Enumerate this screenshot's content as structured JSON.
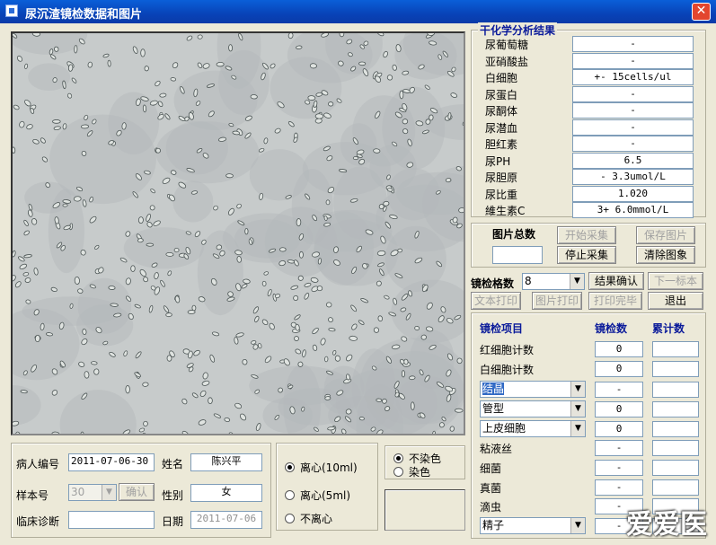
{
  "window": {
    "title": "尿沉渣镜检数据和图片"
  },
  "chem": {
    "title": "干化学分析结果",
    "items": [
      {
        "label": "尿葡萄糖",
        "value": "-"
      },
      {
        "label": "亚硝酸盐",
        "value": "-"
      },
      {
        "label": "白细胞",
        "value": "+-  15cells/ul"
      },
      {
        "label": "尿蛋白",
        "value": "-"
      },
      {
        "label": "尿酮体",
        "value": "-"
      },
      {
        "label": "尿潜血",
        "value": "-"
      },
      {
        "label": "胆红素",
        "value": "-"
      },
      {
        "label": "尿PH",
        "value": "6.5"
      },
      {
        "label": "尿胆原",
        "value": "-   3.3umol/L"
      },
      {
        "label": "尿比重",
        "value": "1.020"
      },
      {
        "label": "維生素C",
        "value": "3+  6.0mmol/L"
      }
    ]
  },
  "images": {
    "total_label": "图片总数",
    "total_value": "",
    "start_btn": "开始采集",
    "save_btn": "保存图片",
    "stop_btn": "停止采集",
    "clear_btn": "清除图象"
  },
  "exam": {
    "grid_label": "镜检格数",
    "grid_value": "8",
    "confirm_btn": "结果确认",
    "next_btn": "下一标本",
    "print_text_btn": "文本打印",
    "print_img_btn": "图片打印",
    "print_done_btn": "打印完毕",
    "exit_btn": "退出"
  },
  "results": {
    "col_item": "镜检项目",
    "col_count": "镜检数",
    "col_total": "累计数",
    "rows": [
      {
        "item": "红细胞计数",
        "count": "0",
        "total": "",
        "combo": false
      },
      {
        "item": "白细胞计数",
        "count": "0",
        "total": "",
        "combo": false
      },
      {
        "item": "结晶",
        "count": "-",
        "total": "",
        "combo": true,
        "selected": true
      },
      {
        "item": "管型",
        "count": "0",
        "total": "",
        "combo": true
      },
      {
        "item": "上皮细胞",
        "count": "0",
        "total": "",
        "combo": true
      },
      {
        "item": "粘液丝",
        "count": "-",
        "total": "",
        "combo": false
      },
      {
        "item": "细菌",
        "count": "-",
        "total": "",
        "combo": false
      },
      {
        "item": "真菌",
        "count": "-",
        "total": "",
        "combo": false
      },
      {
        "item": "滴虫",
        "count": "-",
        "total": "",
        "combo": false
      },
      {
        "item": "精子",
        "count": "-",
        "total": "",
        "combo": true
      }
    ]
  },
  "patient": {
    "id_label": "病人编号",
    "id_value": "2011-07-06-30",
    "name_label": "姓名",
    "name_value": "陈兴平",
    "sample_label": "样本号",
    "sample_value": "30",
    "confirm_btn": "确认",
    "sex_label": "性别",
    "sex_value": "女",
    "diag_label": "临床诊断",
    "diag_value": "",
    "date_label": "日期",
    "date_value": "2011-07-06"
  },
  "centrifuge": {
    "options": [
      "离心(10ml)",
      "离心(5ml)",
      "不离心"
    ],
    "selected": 0
  },
  "stain": {
    "options": [
      "不染色",
      "染色"
    ],
    "selected": 0
  },
  "watermark": "爱爱医"
}
